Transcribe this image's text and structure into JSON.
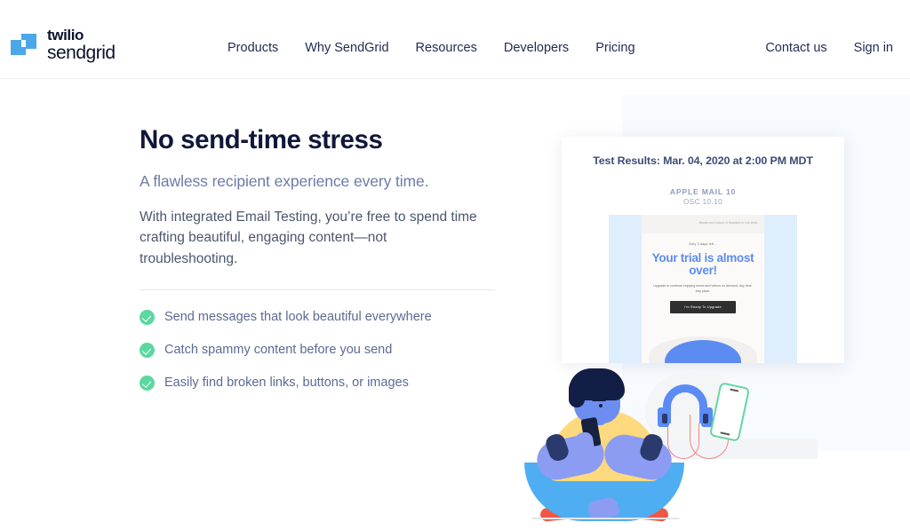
{
  "header": {
    "logo": {
      "brand_top": "twilio",
      "brand_bottom": "sendgrid",
      "mark_icon": "twilio-logo-icon",
      "mark_color": "#4ba7e8"
    },
    "nav_main": [
      {
        "label": "Products"
      },
      {
        "label": "Why SendGrid"
      },
      {
        "label": "Resources"
      },
      {
        "label": "Developers"
      },
      {
        "label": "Pricing"
      }
    ],
    "nav_right": [
      {
        "label": "Contact us"
      },
      {
        "label": "Sign in"
      }
    ]
  },
  "hero": {
    "headline": "No send-time stress",
    "subheadline": "A flawless recipient experience every time.",
    "body": "With integrated Email Testing, you’re free to spend time crafting beautiful, engaging content—not troubleshooting.",
    "features": [
      {
        "icon": "check-circle-icon",
        "label": "Send messages that look beautiful everywhere"
      },
      {
        "icon": "check-circle-icon",
        "label": "Catch spammy content before you send"
      },
      {
        "icon": "check-circle-icon",
        "label": "Easily find broken links, buttons, or images"
      }
    ],
    "colors": {
      "headline": "#10173a",
      "subheadline": "#6c7ba8",
      "body": "#4c566e",
      "feature_text": "#5b6a94",
      "check_green": "#5bd89f"
    }
  },
  "preview_card": {
    "title": "Test Results: Mar. 04, 2020 at 2:00 PM MDT",
    "client_name": "APPLE MAIL 10",
    "client_os": "OSC 10.10",
    "email": {
      "topbar_note": "Words and colors of headline in the letter",
      "eyebrow": "Only 3 days left...",
      "heading": "Your trial is almost over!",
      "subtext": "Upgrade to continue enjoying music and videos on demand. Any time. Any place.",
      "cta": "I'm Ready To Upgrade",
      "heading_color": "#5d8cf0",
      "cta_bg": "#2f2f2f"
    }
  },
  "illustration": {
    "name": "person-with-phone-illustration",
    "objects": [
      {
        "name": "headphones-icon"
      },
      {
        "name": "smartphone-icon"
      },
      {
        "name": "seated-person"
      }
    ],
    "colors": {
      "panel_bg": "#f7fafe",
      "shirt": "#ffd97e",
      "pants": "#4fadf2",
      "skin": "#6d8df0",
      "hair": "#121e45",
      "shoes": "#ef5744",
      "headphones": "#5b8bf5",
      "cord": "#f4847e",
      "phone_outline": "#66d6a0"
    }
  }
}
